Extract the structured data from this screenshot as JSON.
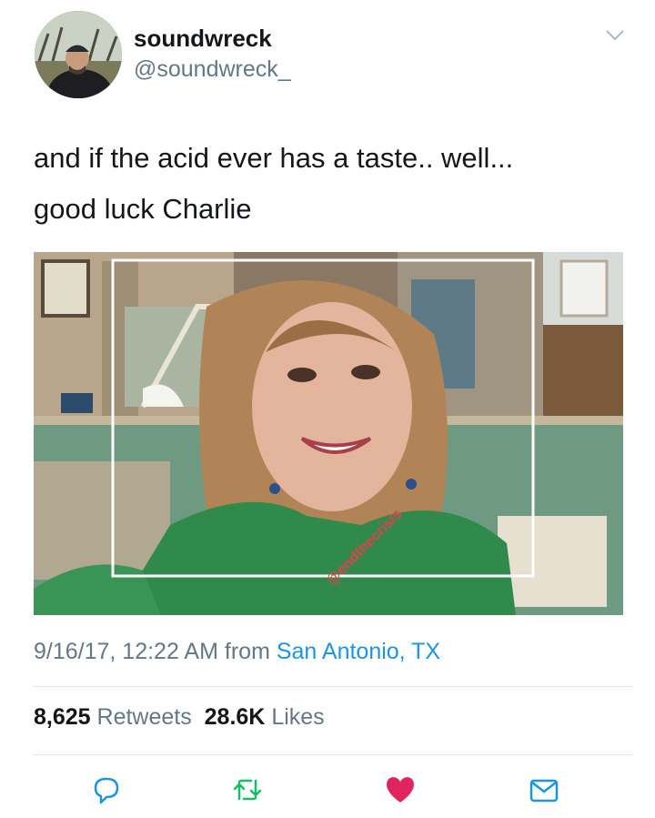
{
  "tweet": {
    "display_name": "soundwreck",
    "handle": "@soundwreck_",
    "text_line1": "and if the acid ever has a taste.. well...",
    "text_line2": "good luck Charlie",
    "date": "9/16/17, 12:22 AM",
    "from_word": "from",
    "location": "San Antonio, TX",
    "retweets_count": "8,625",
    "retweets_label": "Retweets",
    "likes_count": "28.6K",
    "likes_label": "Likes",
    "watermark": "@endthecrisis"
  },
  "colors": {
    "text": "#14171a",
    "secondary": "#657786",
    "link": "#1b95e0",
    "like_active": "#e0245e",
    "retweet": "#17bf63"
  },
  "icons": [
    "chevron-down-icon",
    "reply-icon",
    "retweet-icon",
    "heart-icon",
    "direct-message-icon"
  ]
}
